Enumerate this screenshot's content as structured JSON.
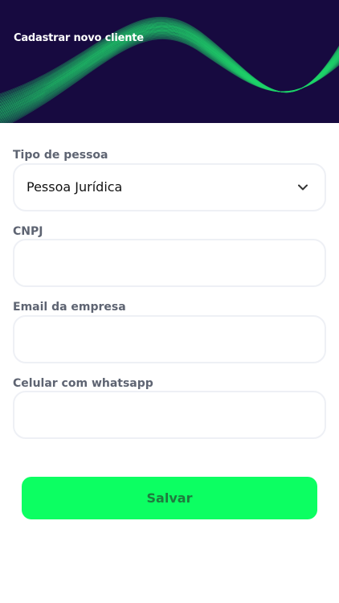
{
  "header": {
    "title": "Cadastrar novo cliente",
    "background_color": "#170a40",
    "wave_color": "#1fd46a"
  },
  "form": {
    "person_type": {
      "label": "Tipo de pessoa",
      "value": "Pessoa Jurídica",
      "icon": "chevron-down-icon"
    },
    "cnpj": {
      "label": "CNPJ",
      "value": ""
    },
    "email": {
      "label": "Email da empresa",
      "value": ""
    },
    "whatsapp": {
      "label": "Celular com whatsapp",
      "value": ""
    }
  },
  "actions": {
    "save_label": "Salvar",
    "save_color": "#0cff62"
  }
}
